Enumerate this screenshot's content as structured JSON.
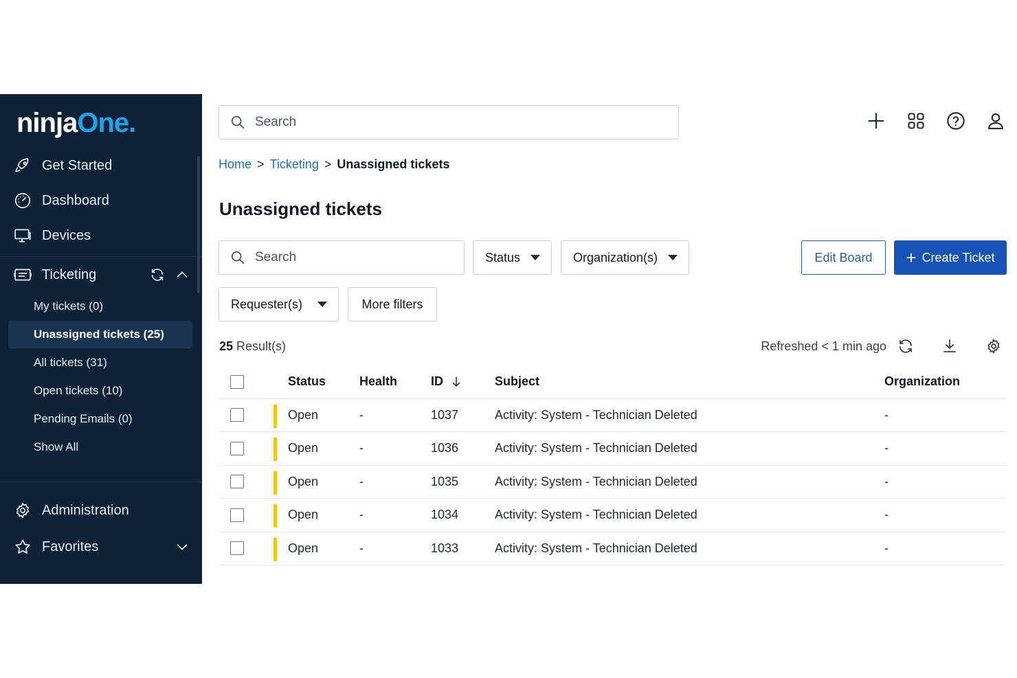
{
  "brand": {
    "part1": "ninja",
    "part2": "One."
  },
  "sidebar": {
    "items": [
      {
        "label": "Get Started",
        "icon": "rocket-icon"
      },
      {
        "label": "Dashboard",
        "icon": "gauge-icon"
      },
      {
        "label": "Devices",
        "icon": "monitor-icon"
      }
    ],
    "ticketing": {
      "label": "Ticketing",
      "icon": "ticket-icon",
      "subitems": [
        {
          "label": "My tickets (0)"
        },
        {
          "label": "Unassigned tickets (25)",
          "active": true
        },
        {
          "label": "All tickets (31)"
        },
        {
          "label": "Open tickets (10)"
        },
        {
          "label": "Pending Emails (0)"
        },
        {
          "label": "Show All"
        }
      ]
    },
    "administration": {
      "label": "Administration",
      "icon": "gear-icon"
    },
    "favorites": {
      "label": "Favorites",
      "icon": "star-icon"
    }
  },
  "topbar": {
    "search_placeholder": "Search",
    "icons": [
      "plus-icon",
      "apps-grid-icon",
      "help-icon",
      "user-icon"
    ]
  },
  "breadcrumb": {
    "home": "Home",
    "section": "Ticketing",
    "current": "Unassigned tickets",
    "separator": ">"
  },
  "page_title": "Unassigned tickets",
  "filters": {
    "search_placeholder": "Search",
    "status": "Status",
    "organizations": "Organization(s)",
    "requesters": "Requester(s)",
    "more": "More filters"
  },
  "actions": {
    "edit_board": "Edit Board",
    "create_ticket": "Create Ticket"
  },
  "results": {
    "count": "25",
    "label": "Result(s)",
    "refreshed": "Refreshed < 1 min ago"
  },
  "table": {
    "columns": {
      "status": "Status",
      "health": "Health",
      "id": "ID",
      "subject": "Subject",
      "organization": "Organization"
    },
    "rows": [
      {
        "status": "Open",
        "health": "-",
        "id": "1037",
        "subject": "Activity: System - Technician Deleted",
        "organization": "-"
      },
      {
        "status": "Open",
        "health": "-",
        "id": "1036",
        "subject": "Activity: System - Technician Deleted",
        "organization": "-"
      },
      {
        "status": "Open",
        "health": "-",
        "id": "1035",
        "subject": "Activity: System - Technician Deleted",
        "organization": "-"
      },
      {
        "status": "Open",
        "health": "-",
        "id": "1034",
        "subject": "Activity: System - Technician Deleted",
        "organization": "-"
      },
      {
        "status": "Open",
        "health": "-",
        "id": "1033",
        "subject": "Activity: System - Technician Deleted",
        "organization": "-"
      }
    ]
  },
  "colors": {
    "sidebar_bg": "#0d2237",
    "accent": "#1652b8",
    "link": "#1d6fd1",
    "status_open": "#f5c40f",
    "brand_one": "#1fa3e8"
  }
}
